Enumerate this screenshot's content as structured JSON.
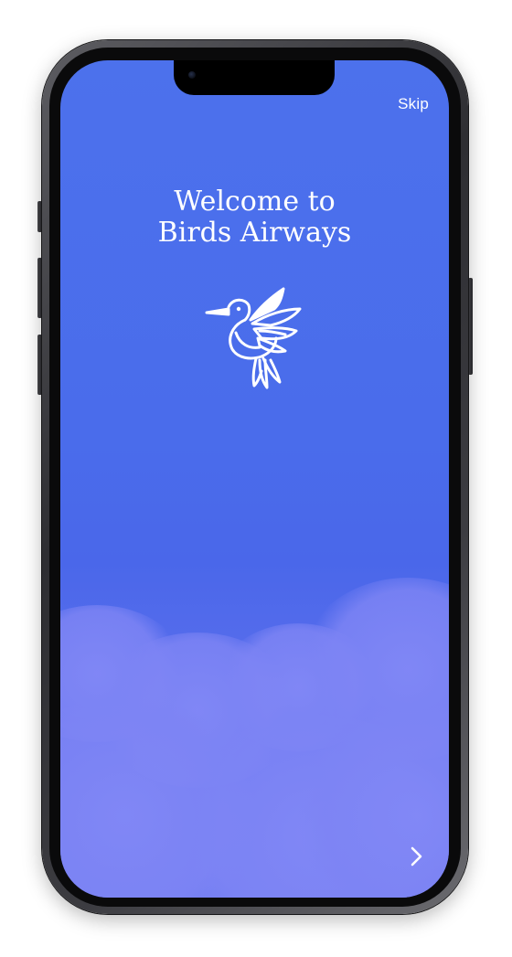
{
  "onboarding": {
    "skip_label": "Skip",
    "title_line1": "Welcome to",
    "title_line2": "Birds Airways"
  },
  "icons": {
    "logo": "hummingbird-logo-icon",
    "next": "chevron-right-icon"
  },
  "colors": {
    "sky_top": "#4c71ec",
    "sky_bottom": "#6f7bf1",
    "text": "#ffffff",
    "frame": "#2e2e32"
  }
}
